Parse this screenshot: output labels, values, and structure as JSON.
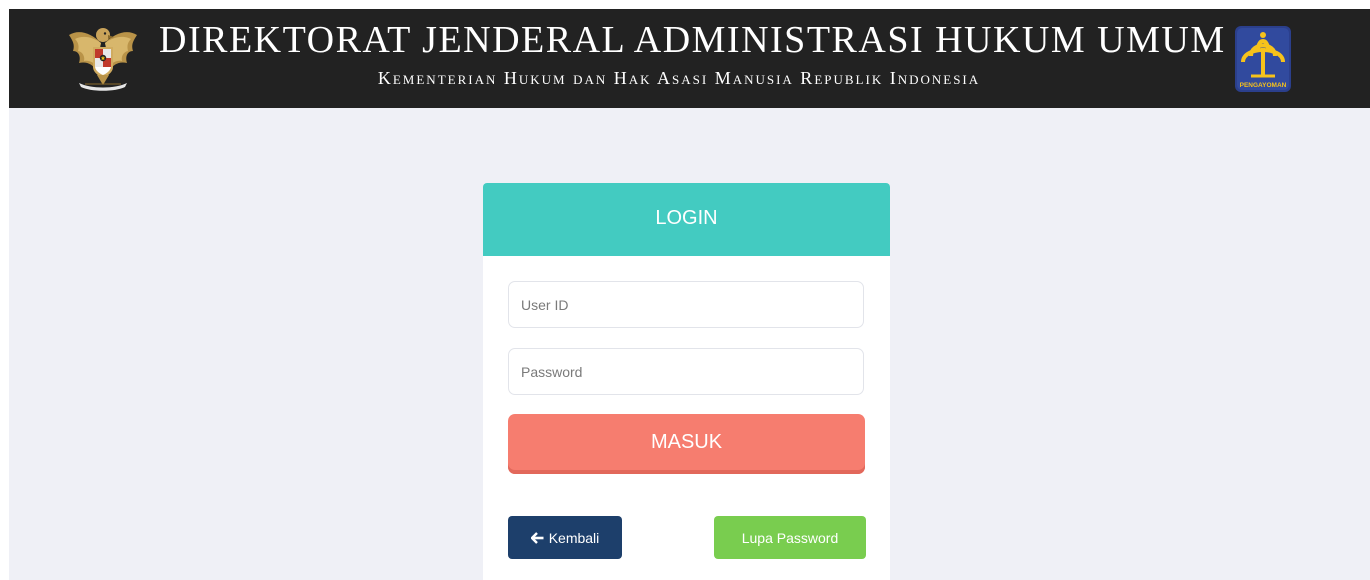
{
  "header": {
    "title": "DIREKTORAT JENDERAL ADMINISTRASI HUKUM UMUM",
    "subtitle": "Kementerian Hukum dan Hak Asasi Manusia Republik Indonesia",
    "right_logo_text": "PENGAYOMAN",
    "left_logo_icon": "garuda-pancasila-emblem",
    "right_logo_icon": "pengayoman-emblem"
  },
  "login": {
    "title": "LOGIN",
    "user_placeholder": "User ID",
    "user_value": "",
    "password_placeholder": "Password",
    "password_value": "",
    "submit_label": "MASUK",
    "back_label": "Kembali",
    "back_icon": "arrow-left-icon",
    "forgot_label": "Lupa Password"
  },
  "colors": {
    "header_bg": "#222222",
    "page_bg": "#eff0f6",
    "login_header": "#43cbc1",
    "masuk": "#f67d6f",
    "kembali": "#1d3f6b",
    "lupa": "#79cd4f"
  }
}
